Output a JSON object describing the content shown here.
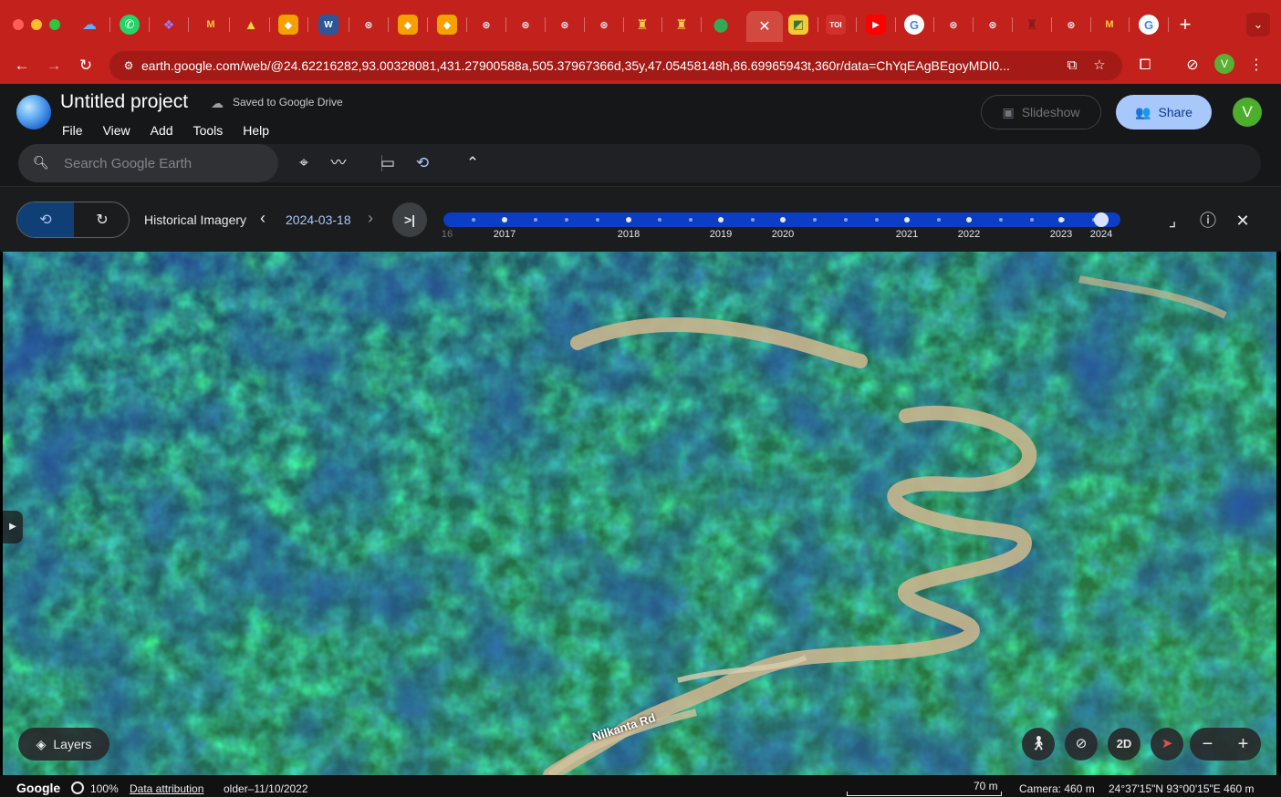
{
  "browser": {
    "tab_badges": [
      "M",
      "W",
      "TOI"
    ],
    "new_tab": "+",
    "tab_search": "⌄",
    "url_host": "earth.google.com",
    "url_path": "/web/@24.62216282,93.00328081,431.27900588a,505.37967366d,35y,47.05458148h,86.69965943t,360r/data=ChYqEAgBEgoyMDI0...",
    "profile_initial": "V"
  },
  "app": {
    "project_title": "Untitled project",
    "saved_status": "Saved to Google Drive",
    "menu": [
      "File",
      "View",
      "Add",
      "Tools",
      "Help"
    ],
    "slideshow_label": "Slideshow",
    "share_label": "Share",
    "avatar_initial": "V",
    "search_placeholder": "Search Google Earth"
  },
  "historical": {
    "label": "Historical Imagery",
    "current_date": "2024-03-18",
    "timeline_years": [
      {
        "label": "16",
        "year": 2016,
        "faded": true
      },
      {
        "label": "2017",
        "year": 2017
      },
      {
        "label": "2018",
        "year": 2018
      },
      {
        "label": "2019",
        "year": 2019
      },
      {
        "label": "2020",
        "year": 2020
      },
      {
        "label": "2021",
        "year": 2021
      },
      {
        "label": "2022",
        "year": 2022
      },
      {
        "label": "2023",
        "year": 2023
      },
      {
        "label": "2024",
        "year": 2024
      }
    ],
    "selected_year": 2024
  },
  "map": {
    "road_label": "Nilkanta Rd",
    "layers_label": "Layers",
    "mode_2d_label": "2D"
  },
  "status": {
    "logo": "Google",
    "zoom": "100%",
    "data_attribution": "Data attribution",
    "imagery_date": "older–11/10/2022",
    "scale": "70 m",
    "camera": "Camera: 460 m",
    "coords": "24°37'15\"N 93°00'15\"E  460 m"
  },
  "colors": {
    "chrome_red": "#c2211c",
    "accent_blue": "#a8c7fa",
    "timeline_blue": "#0b3ec4",
    "avatar_green": "#4cae2b"
  }
}
